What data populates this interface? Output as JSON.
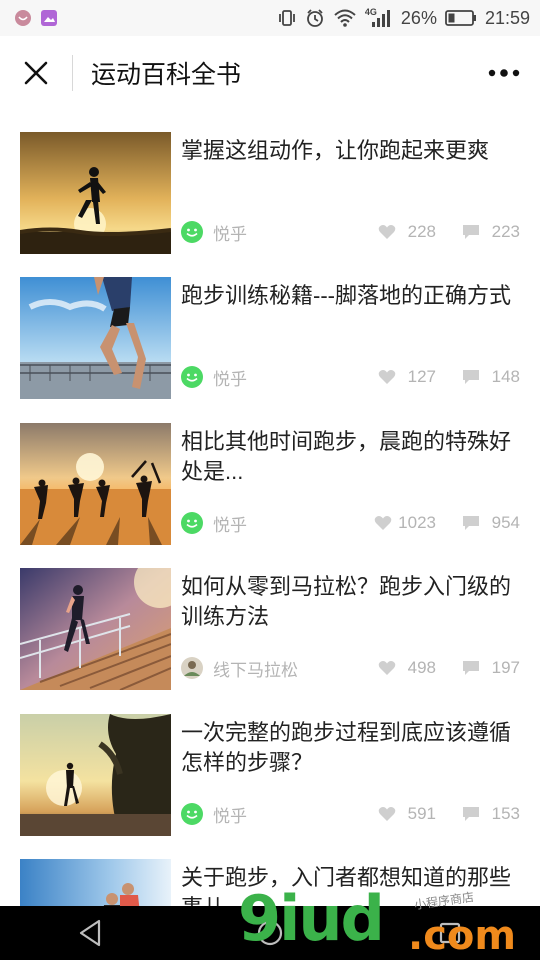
{
  "status_bar": {
    "network": "4G",
    "battery": "26%",
    "time": "21:59"
  },
  "header": {
    "title": "运动百科全书"
  },
  "articles": [
    {
      "title": "掌握这组动作，让你跑起来更爽",
      "source": "悦乎",
      "likes": "228",
      "comments": "223",
      "source_icon": "smile-icon"
    },
    {
      "title": "跑步训练秘籍---脚落地的正确方式",
      "source": "悦乎",
      "likes": "127",
      "comments": "148",
      "source_icon": "smile-icon"
    },
    {
      "title": "相比其他时间跑步，晨跑的特殊好处是...",
      "source": "悦乎",
      "likes": "1023",
      "comments": "954",
      "source_icon": "smile-icon"
    },
    {
      "title": "如何从零到马拉松？跑步入门级的训练方法",
      "source": "线下马拉松",
      "likes": "498",
      "comments": "197",
      "source_icon": "avatar-icon"
    },
    {
      "title": "一次完整的跑步过程到底应该遵循怎样的步骤？",
      "source": "悦乎",
      "likes": "591",
      "comments": "153",
      "source_icon": "smile-icon"
    },
    {
      "title": "关于跑步，入门者都想知道的那些事儿",
      "source": "",
      "likes": "",
      "comments": "",
      "source_icon": ""
    }
  ],
  "watermark": {
    "main": "9iud",
    "suffix": ".com",
    "small": "小程序商店"
  },
  "colors": {
    "accent_green": "#4cd964",
    "meta_gray": "#b4b4b4"
  }
}
